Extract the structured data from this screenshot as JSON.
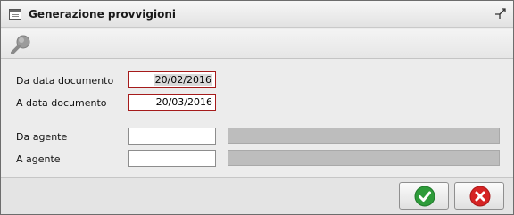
{
  "window": {
    "title": "Generazione provvigioni"
  },
  "toolbar": {
    "search_icon": "magnifier-icon"
  },
  "form": {
    "da_data_label": "Da data documento",
    "da_data_value": "20/02/2016",
    "a_data_label": "A data documento",
    "a_data_value": "20/03/2016",
    "da_agente_label": "Da agente",
    "da_agente_value": "",
    "a_agente_label": "A agente",
    "a_agente_value": ""
  },
  "footer": {
    "confirm_icon": "check-icon",
    "cancel_icon": "close-icon"
  },
  "colors": {
    "required_border": "#a51b1b",
    "confirm_green": "#2e9b3a",
    "cancel_red": "#d62424"
  }
}
